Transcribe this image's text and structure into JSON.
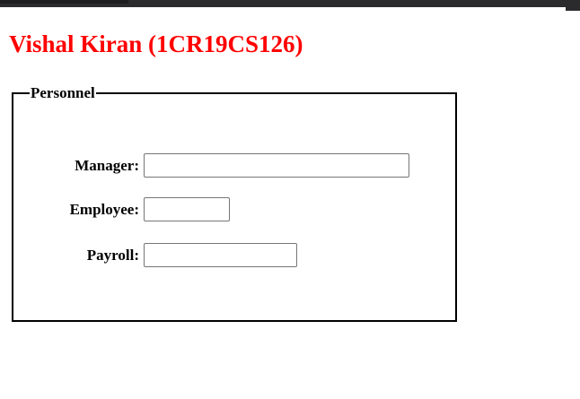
{
  "page": {
    "title": "Vishal Kiran (1CR19CS126)"
  },
  "form": {
    "legend": "Personnel",
    "fields": [
      {
        "label": "Manager:",
        "value": ""
      },
      {
        "label": "Employee:",
        "value": ""
      },
      {
        "label": "Payroll:",
        "value": ""
      }
    ]
  },
  "colors": {
    "title": "#ff0000",
    "text": "#000000",
    "input_border": "#767676",
    "browser_bar": "#2b2b2e"
  }
}
